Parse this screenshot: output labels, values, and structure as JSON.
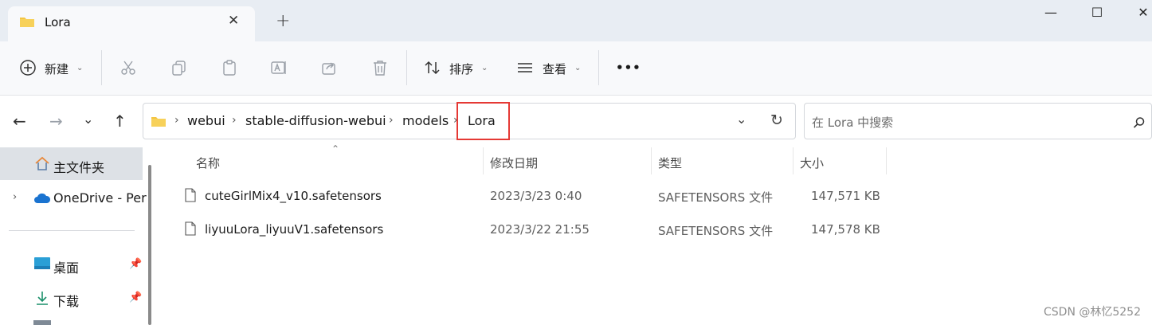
{
  "window": {
    "tab_title": "Lora",
    "tab_close": "✕",
    "new_tab": "+",
    "minimize": "—",
    "maximize": "☐",
    "close": "✕"
  },
  "toolbar": {
    "new_label": "新建",
    "sort_label": "排序",
    "view_label": "查看",
    "more_label": "•••"
  },
  "address": {
    "crumbs": [
      "webui",
      "stable-diffusion-webui",
      "models",
      "Lora"
    ],
    "separator": "›",
    "search_placeholder": "在 Lora 中搜索"
  },
  "sidebar": {
    "items": [
      {
        "label": "主文件夹"
      },
      {
        "label": "OneDrive - Per"
      },
      {
        "label": "桌面"
      },
      {
        "label": "下载"
      }
    ]
  },
  "columns": [
    "名称",
    "修改日期",
    "类型",
    "大小"
  ],
  "files": [
    {
      "name": "cuteGirlMix4_v10.safetensors",
      "modified": "2023/3/23 0:40",
      "type": "SAFETENSORS 文件",
      "size": "147,571 KB"
    },
    {
      "name": "liyuuLora_liyuuV1.safetensors",
      "modified": "2023/3/22 21:55",
      "type": "SAFETENSORS 文件",
      "size": "147,578 KB"
    }
  ],
  "watermark": "CSDN @林忆5252",
  "colors": {
    "accent": "#0067c0",
    "highlight": "#e53935",
    "folder": "#f4c542"
  }
}
